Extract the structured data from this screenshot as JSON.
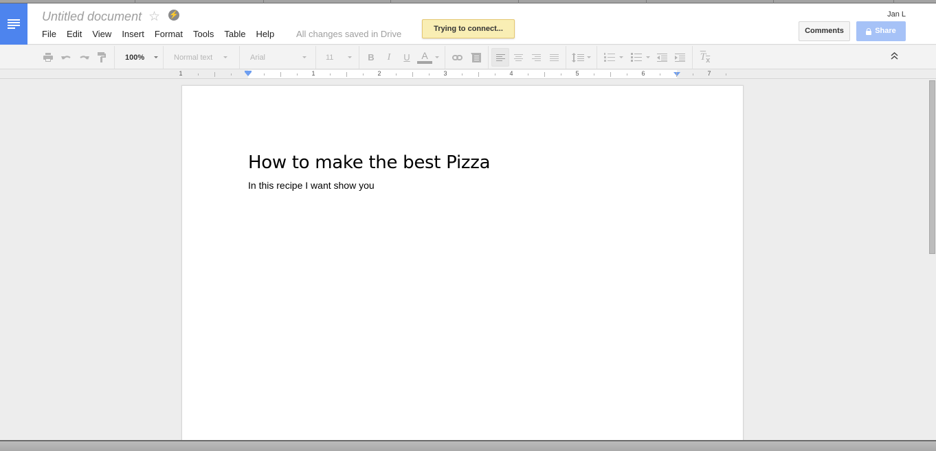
{
  "app": {
    "doc_title": "Untitled document",
    "save_status": "All changes saved in Drive",
    "connection_toast": "Trying to connect...",
    "user_name": "Jan L",
    "logo_icon": "docs-menu-icon",
    "star_icon": "☆",
    "offline_icon": "⚡"
  },
  "menu": {
    "items": [
      {
        "label": "File"
      },
      {
        "label": "Edit"
      },
      {
        "label": "View"
      },
      {
        "label": "Insert"
      },
      {
        "label": "Format"
      },
      {
        "label": "Tools"
      },
      {
        "label": "Table"
      },
      {
        "label": "Help"
      }
    ]
  },
  "buttons": {
    "comments": "Comments",
    "share": "Share"
  },
  "toolbar": {
    "zoom": "100%",
    "style": "Normal text",
    "font": "Arial",
    "font_size": "11",
    "bold": "B",
    "italic": "I",
    "underline": "U",
    "text_color": "A",
    "print_icon": "🖶",
    "undo_icon": "↶",
    "redo_icon": "↷",
    "link_icon": "⊂⊃",
    "clear_format": "T",
    "collapse_icon": "⌃"
  },
  "ruler": {
    "labels": [
      "1",
      "1",
      "2",
      "3",
      "4",
      "5",
      "6",
      "7"
    ]
  },
  "document": {
    "heading": "How to make the best Pizza",
    "body": "In this recipe I want show you"
  },
  "colors": {
    "brand": "#4d84ee",
    "share_button": "#a6c2f7",
    "toast_bg": "#f9eeb4"
  }
}
